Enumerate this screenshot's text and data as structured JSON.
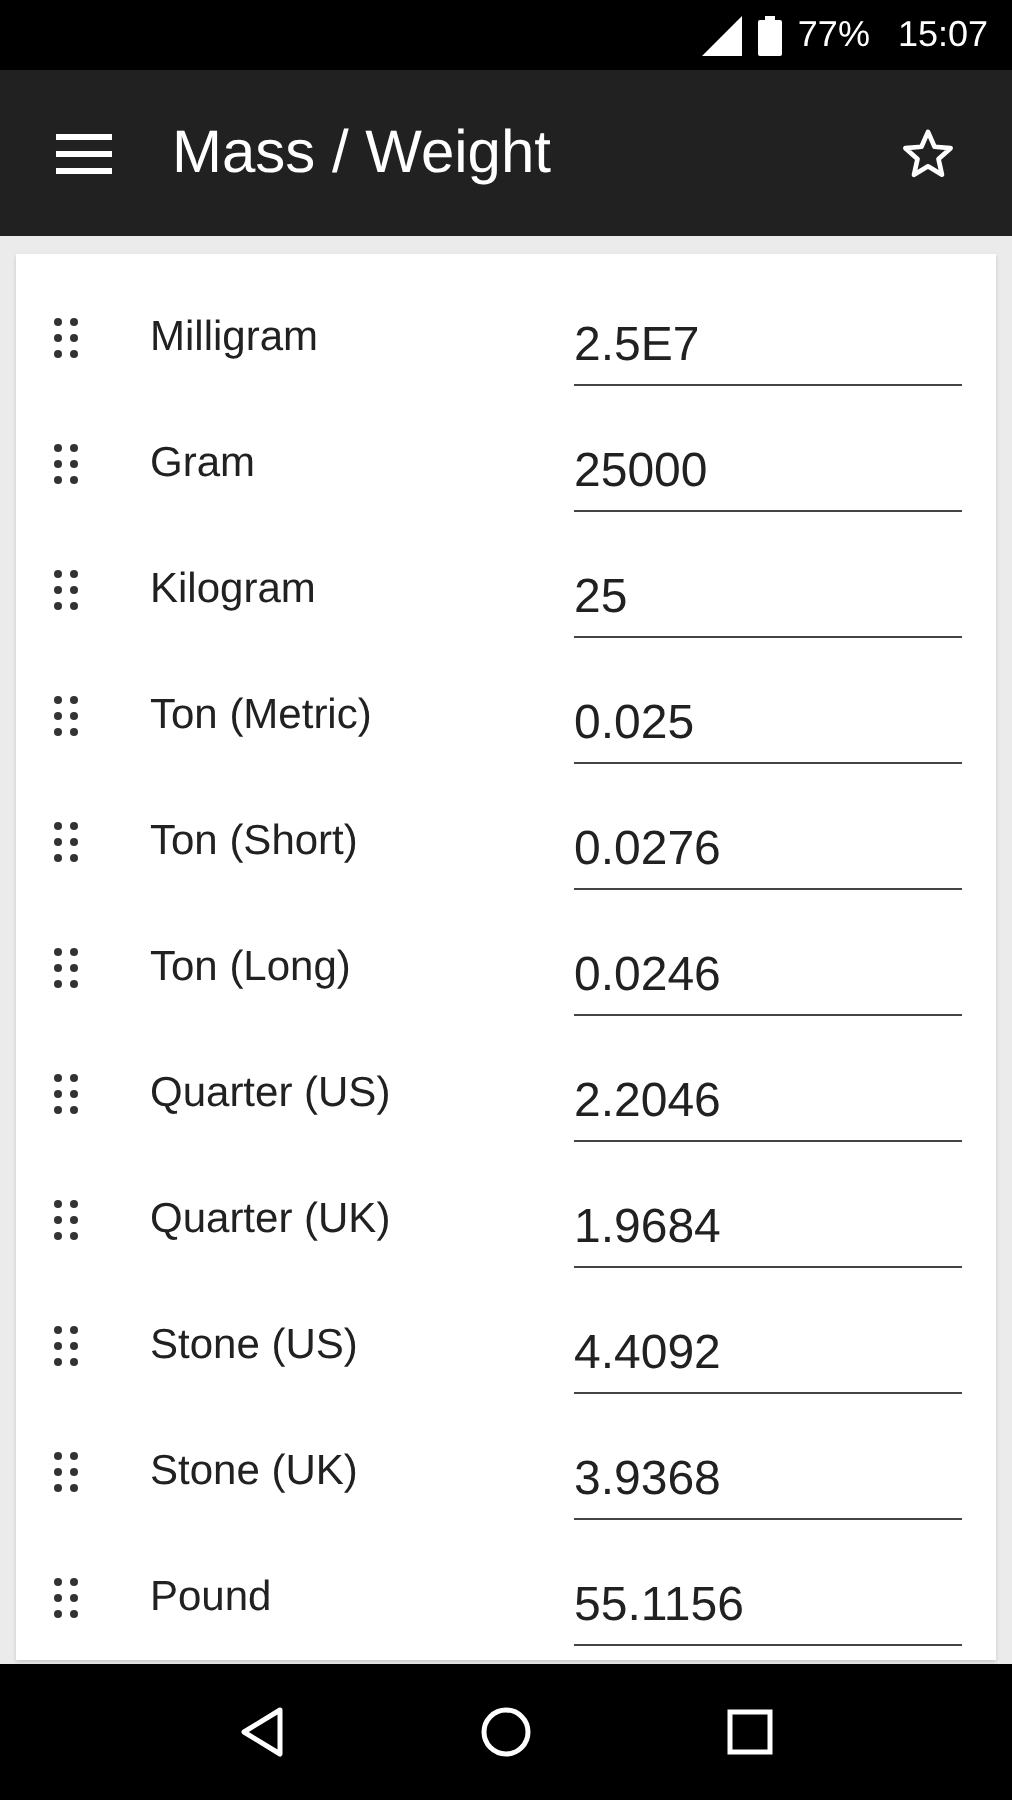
{
  "status_bar": {
    "battery": "77%",
    "time": "15:07"
  },
  "app_bar": {
    "title": "Mass / Weight",
    "favorite": false
  },
  "units": [
    {
      "name": "Milligram",
      "value": "2.5E7"
    },
    {
      "name": "Gram",
      "value": "25000"
    },
    {
      "name": "Kilogram",
      "value": "25"
    },
    {
      "name": "Ton (Metric)",
      "value": "0.025"
    },
    {
      "name": "Ton (Short)",
      "value": "0.0276"
    },
    {
      "name": "Ton (Long)",
      "value": "0.0246"
    },
    {
      "name": "Quarter (US)",
      "value": "2.2046"
    },
    {
      "name": "Quarter (UK)",
      "value": "1.9684"
    },
    {
      "name": "Stone (US)",
      "value": "4.4092"
    },
    {
      "name": "Stone (UK)",
      "value": "3.9368"
    },
    {
      "name": "Pound",
      "value": "55.1156"
    }
  ]
}
